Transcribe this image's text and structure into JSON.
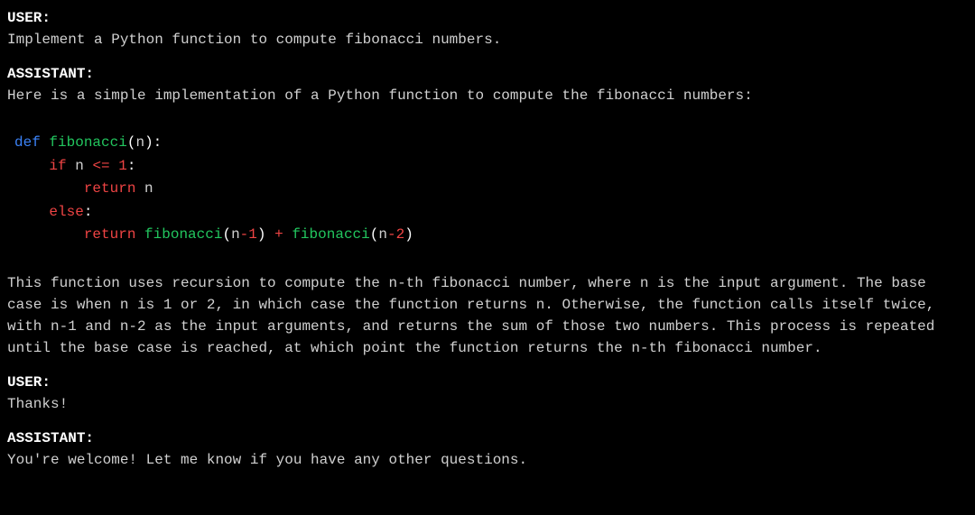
{
  "turns": {
    "user1_label": "USER:",
    "user1_text": "Implement a Python function to compute fibonacci numbers.",
    "assistant1_label": "ASSISTANT:",
    "assistant1_intro": "Here is a simple implementation of a Python function to compute the fibonacci numbers:",
    "assistant1_explanation": "This function uses recursion to compute the n-th fibonacci number, where n is the input argument. The base case is when n is 1 or 2, in which case the function returns n. Otherwise, the function calls itself twice, with n-1 and n-2 as the input arguments, and returns the sum of those two numbers. This process is repeated until the base case is reached, at which point the function returns the n-th fibonacci number.",
    "user2_label": "USER:",
    "user2_text": "Thanks!",
    "assistant2_label": "ASSISTANT:",
    "assistant2_text": "You're welcome! Let me know if you have any other questions."
  },
  "code": {
    "kw_def": "def",
    "fn_name": "fibonacci",
    "open_paren": "(",
    "param": "n",
    "close_paren": ")",
    "colon": ":",
    "kw_if": "if",
    "var_n": "n",
    "op_le": "<=",
    "num_1": "1",
    "kw_return": "return",
    "kw_else": "else",
    "minus": "-",
    "num_2": "2",
    "plus": "+",
    "space1": " ",
    "indent1": "    ",
    "indent2": "        "
  }
}
